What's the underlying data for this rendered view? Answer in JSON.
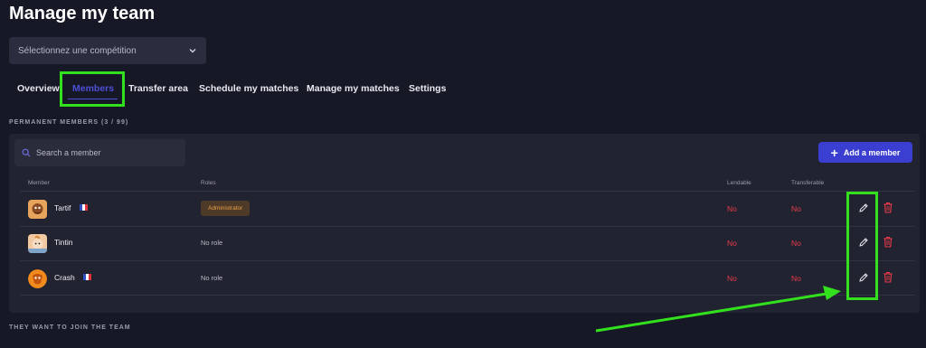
{
  "page": {
    "title": "Manage my team"
  },
  "competition_select": {
    "value": "Sélectionnez une compétition"
  },
  "tabs": [
    {
      "label": "Overview"
    },
    {
      "label": "Members",
      "active": true
    },
    {
      "label": "Transfer area"
    },
    {
      "label": "Schedule my matches"
    },
    {
      "label": "Manage my matches"
    },
    {
      "label": "Settings"
    }
  ],
  "permanent_members": {
    "heading": "PERMANENT MEMBERS (3 / 99)",
    "search_placeholder": "Search a member",
    "add_button": "Add a member",
    "columns": {
      "member": "Member",
      "roles": "Roles",
      "lendable": "Lendable",
      "transferable": "Transferable"
    },
    "rows": [
      {
        "name": "Tartif",
        "flag": "france",
        "role": "Administrator",
        "role_is_badge": true,
        "lendable": "No",
        "transferable": "No"
      },
      {
        "name": "Tintin",
        "flag": "",
        "role": "No role",
        "role_is_badge": false,
        "lendable": "No",
        "transferable": "No"
      },
      {
        "name": "Crash",
        "flag": "france",
        "role": "No role",
        "role_is_badge": false,
        "lendable": "No",
        "transferable": "No"
      }
    ]
  },
  "join_requests": {
    "heading": "THEY WANT TO JOIN THE TEAM"
  },
  "colors": {
    "background": "#171826",
    "panel": "#222331",
    "accent": "#3b3fd1",
    "negative": "#e83a4a",
    "badge_bg": "#4e3a28",
    "badge_text": "#e9a24a",
    "highlight": "#32e01d"
  },
  "icons": [
    "chevron-down-icon",
    "search-icon",
    "plus-icon",
    "pencil-icon",
    "trash-icon",
    "france-flag-icon"
  ]
}
